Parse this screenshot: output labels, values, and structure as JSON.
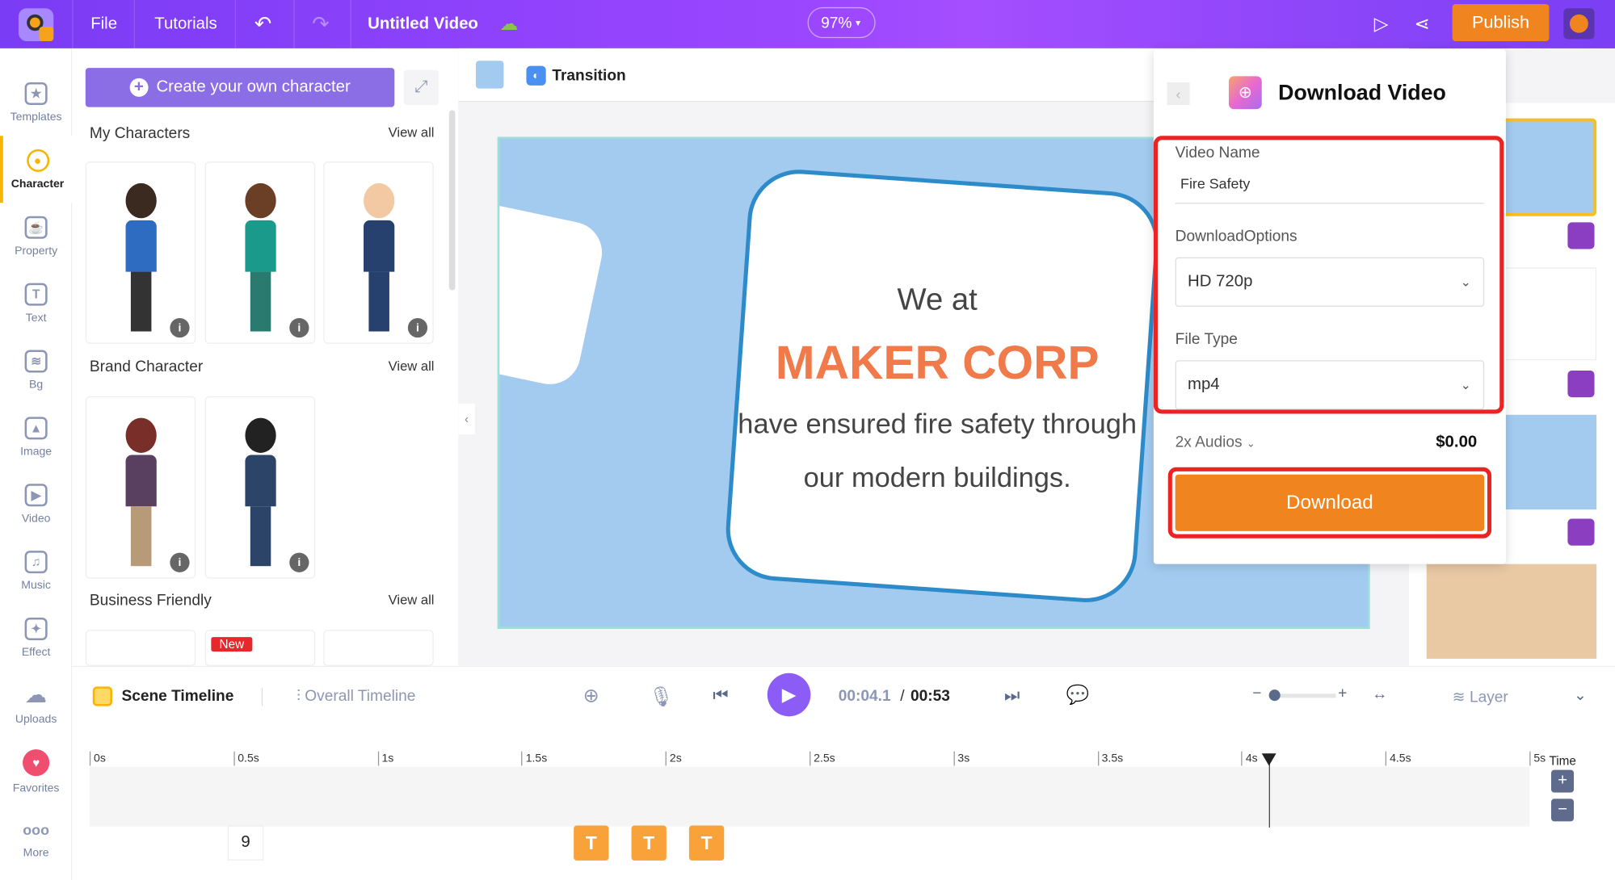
{
  "topbar": {
    "file": "File",
    "tutorials": "Tutorials",
    "title": "Untitled Video",
    "zoom": "97%",
    "publish": "Publish"
  },
  "rail": [
    {
      "label": "Templates",
      "icon": "templates-icon"
    },
    {
      "label": "Character",
      "icon": "character-icon"
    },
    {
      "label": "Property",
      "icon": "property-icon"
    },
    {
      "label": "Text",
      "icon": "text-icon"
    },
    {
      "label": "Bg",
      "icon": "bg-icon"
    },
    {
      "label": "Image",
      "icon": "image-icon"
    },
    {
      "label": "Video",
      "icon": "video-icon"
    },
    {
      "label": "Music",
      "icon": "music-icon"
    },
    {
      "label": "Effect",
      "icon": "effect-icon"
    },
    {
      "label": "Uploads",
      "icon": "uploads-icon"
    },
    {
      "label": "Favorites",
      "icon": "heart-icon"
    },
    {
      "label": "More",
      "icon": "more-icon"
    }
  ],
  "panel": {
    "create": "Create your own character",
    "my": "My Characters",
    "brand": "Brand Character",
    "business": "Business Friendly",
    "view_all": "View all",
    "new_badge": "New",
    "info": "i"
  },
  "toolbar": {
    "transition": "Transition"
  },
  "stage": {
    "line1": "We at",
    "line2": "MAKER CORP",
    "line3": "have ensured fire safety through",
    "line4": "our modern buildings."
  },
  "download": {
    "title": "Download Video",
    "video_name_label": "Video Name",
    "video_name": "Fire Safety",
    "options_label": "DownloadOptions",
    "option": "HD 720p",
    "filetype_label": "File Type",
    "filetype": "mp4",
    "audios": "2x Audios",
    "price": "$0.00",
    "button": "Download"
  },
  "timeline": {
    "scene": "Scene Timeline",
    "overall": "Overall Timeline",
    "current": "00:04.1",
    "sep": "/",
    "total": "00:53",
    "layer": "Layer",
    "time": "Time",
    "ticks": [
      "0s",
      "0.5s",
      "1s",
      "1.5s",
      "2s",
      "2.5s",
      "3s",
      "3.5s",
      "4s",
      "4.5s",
      "5s"
    ],
    "scene_number": "9",
    "text_block": "T"
  },
  "colors": {
    "accent": "#8b5cf6",
    "publish": "#f0841e",
    "download": "#f0841e",
    "highlight": "#ec2323",
    "title_text": "#f07a4a"
  }
}
